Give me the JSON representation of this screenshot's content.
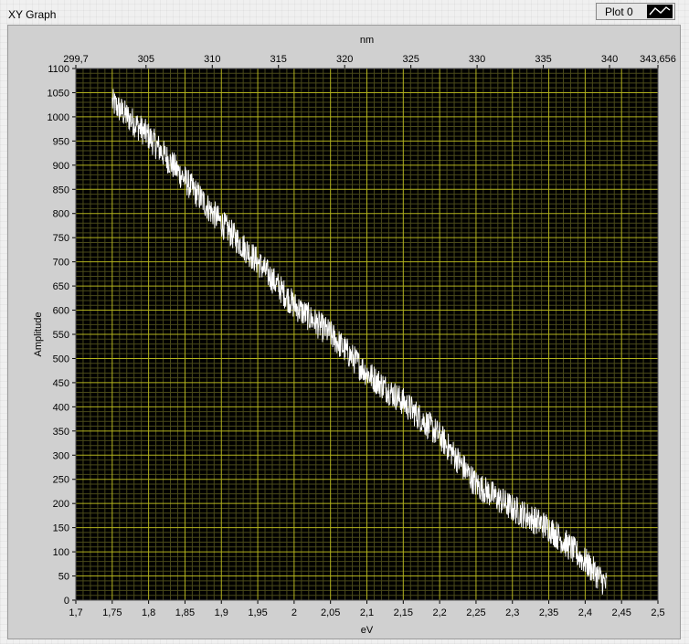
{
  "window": {
    "title": "XY Graph"
  },
  "legend": {
    "plot_name": "Plot 0",
    "icon": "line-plot-icon"
  },
  "colors": {
    "plot_background": "#000000",
    "major_grid": "#b3b31e",
    "minor_grid": "#4a4a1a",
    "trace": "#ffffff",
    "panel": "#d0d0d0"
  },
  "chart_data": {
    "type": "line",
    "xlabel": "eV",
    "x2label": "nm",
    "ylabel": "Amplitude",
    "xlim": [
      1.7,
      2.5
    ],
    "ylim": [
      0,
      1100
    ],
    "grid": true,
    "x_ticks": [
      "1,7",
      "1,75",
      "1,8",
      "1,85",
      "1,9",
      "1,95",
      "2",
      "2,05",
      "2,1",
      "2,15",
      "2,2",
      "2,25",
      "2,3",
      "2,35",
      "2,4",
      "2,45",
      "2,5"
    ],
    "y_ticks": [
      "0",
      "50",
      "100",
      "150",
      "200",
      "250",
      "300",
      "350",
      "400",
      "450",
      "500",
      "550",
      "600",
      "650",
      "700",
      "750",
      "800",
      "850",
      "900",
      "950",
      "1000",
      "1050",
      "1100"
    ],
    "x2_ticks": [
      {
        "label": "299,7",
        "value": 299.7
      },
      {
        "label": "305",
        "value": 305
      },
      {
        "label": "310",
        "value": 310
      },
      {
        "label": "315",
        "value": 315
      },
      {
        "label": "320",
        "value": 320
      },
      {
        "label": "325",
        "value": 325
      },
      {
        "label": "330",
        "value": 330
      },
      {
        "label": "335",
        "value": 335
      },
      {
        "label": "340",
        "value": 340
      },
      {
        "label": "343,656",
        "value": 343.656
      }
    ],
    "x2lim": [
      299.7,
      343.656
    ],
    "series": [
      {
        "x": [
          1.75,
          1.8,
          1.85,
          1.9,
          1.95,
          2.0,
          2.05,
          2.1,
          2.15,
          2.2,
          2.25,
          2.3,
          2.35,
          2.4,
          2.43
        ],
        "y": [
          1030,
          960,
          870,
          780,
          700,
          610,
          550,
          470,
          410,
          340,
          240,
          190,
          150,
          80,
          30
        ],
        "noise_amplitude": 30
      }
    ]
  }
}
